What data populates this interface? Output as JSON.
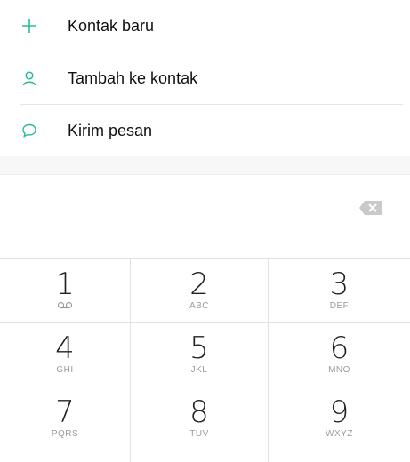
{
  "actions": [
    {
      "label": "Kontak baru",
      "icon": "plus-icon"
    },
    {
      "label": "Tambah ke kontak",
      "icon": "person-icon"
    },
    {
      "label": "Kirim pesan",
      "icon": "message-bubble-icon"
    }
  ],
  "accent_color": "#2bb99a",
  "dial": {
    "number": "",
    "backspace_icon": "backspace-icon"
  },
  "keys": [
    {
      "digit": "1",
      "letters": "",
      "icon": "voicemail-icon"
    },
    {
      "digit": "2",
      "letters": "ABC"
    },
    {
      "digit": "3",
      "letters": "DEF"
    },
    {
      "digit": "4",
      "letters": "GHI"
    },
    {
      "digit": "5",
      "letters": "JKL"
    },
    {
      "digit": "6",
      "letters": "MNO"
    },
    {
      "digit": "7",
      "letters": "PQRS"
    },
    {
      "digit": "8",
      "letters": "TUV"
    },
    {
      "digit": "9",
      "letters": "WXYZ"
    }
  ]
}
